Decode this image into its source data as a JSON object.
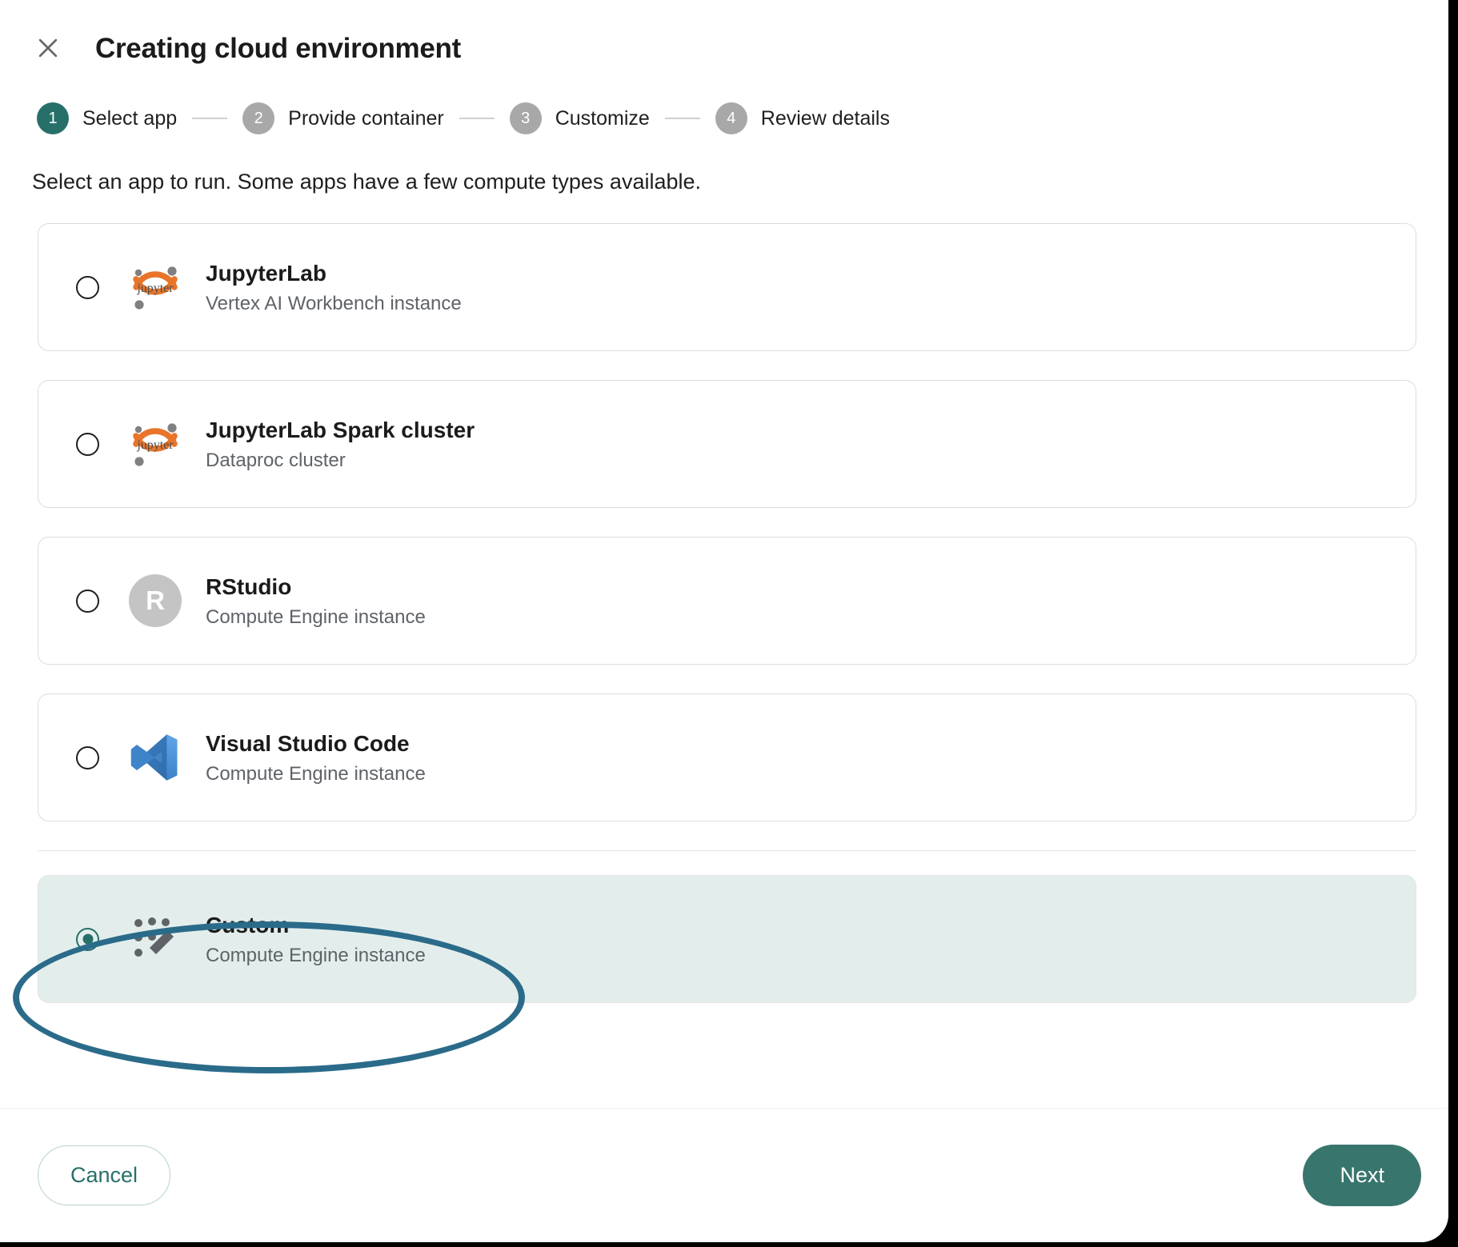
{
  "window": {
    "title": "Creating cloud environment",
    "close_icon": "close-icon"
  },
  "stepper": {
    "steps": [
      {
        "number": "1",
        "label": "Select app",
        "state": "active"
      },
      {
        "number": "2",
        "label": "Provide container",
        "state": "inactive"
      },
      {
        "number": "3",
        "label": "Customize",
        "state": "inactive"
      },
      {
        "number": "4",
        "label": "Review details",
        "state": "inactive"
      }
    ]
  },
  "main": {
    "description": "Select an app to run. Some apps have a few compute types available.",
    "options": [
      {
        "title": "JupyterLab",
        "subtitle": "Vertex AI Workbench instance",
        "icon": "jupyter-logo-icon",
        "selected": false
      },
      {
        "title": "JupyterLab Spark cluster",
        "subtitle": "Dataproc cluster",
        "icon": "jupyter-logo-icon",
        "selected": false
      },
      {
        "title": "RStudio",
        "subtitle": "Compute Engine instance",
        "icon": "rstudio-logo-icon",
        "icon_letter": "R",
        "selected": false
      },
      {
        "title": "Visual Studio Code",
        "subtitle": "Compute Engine instance",
        "icon": "vscode-logo-icon",
        "selected": false
      },
      {
        "title": "Custom",
        "subtitle": "Compute Engine instance",
        "icon": "magic-wand-icon",
        "selected": true
      }
    ]
  },
  "footer": {
    "cancel_label": "Cancel",
    "next_label": "Next"
  },
  "colors": {
    "accent_green": "#27706a",
    "next_button": "#38756d",
    "selected_row_bg": "#e3eeec",
    "highlight_ring": "#2b6b8a",
    "jupyter_orange": "#e8752a",
    "vscode_blue": "#4f9bd9"
  }
}
